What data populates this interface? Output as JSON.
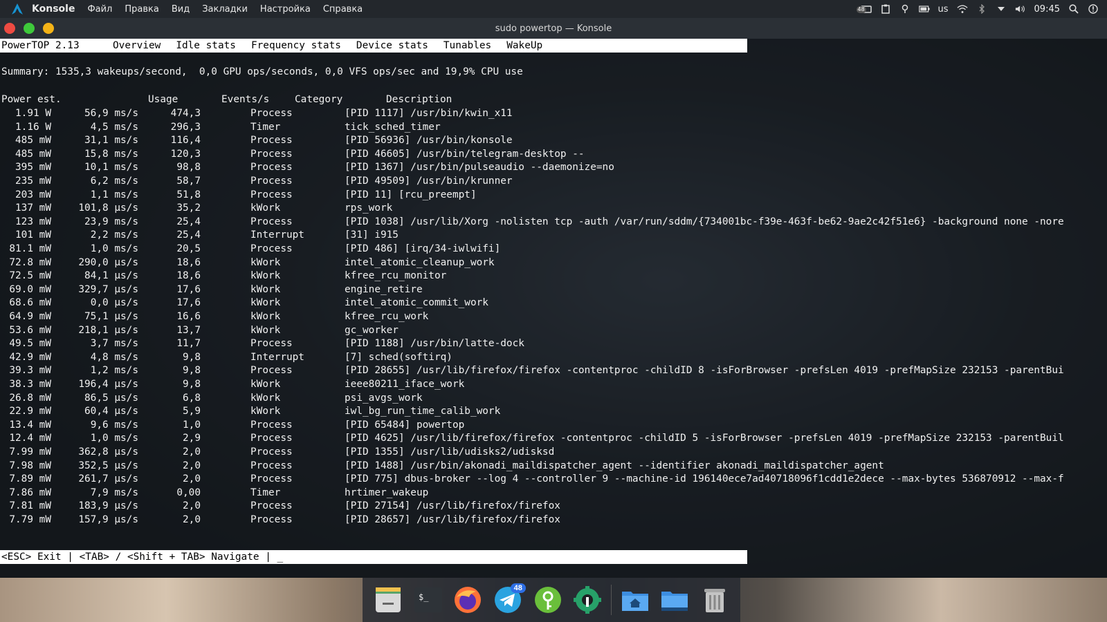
{
  "top_panel": {
    "app_name": "Konsole",
    "menu": [
      "Файл",
      "Правка",
      "Вид",
      "Закладки",
      "Настройка",
      "Справка"
    ],
    "tray": {
      "notifications_badge": "48",
      "keyboard_layout": "us",
      "clock": "09:45"
    }
  },
  "window": {
    "title": "sudo powertop — Konsole"
  },
  "powertop": {
    "version": "PowerTOP 2.13",
    "tabs": [
      "Overview",
      "Idle stats",
      "Frequency stats",
      "Device stats",
      "Tunables",
      "WakeUp"
    ],
    "active_tab": "Overview",
    "summary": "Summary: 1535,3 wakeups/second,  0,0 GPU ops/seconds, 0,0 VFS ops/sec and 19,9% CPU use",
    "columns": {
      "power": "Power est.",
      "usage": "Usage",
      "events": "Events/s",
      "category": "Category",
      "description": "Description"
    },
    "rows": [
      {
        "power": "1.91 W",
        "usage": "56,9 ms/s",
        "events": "474,3",
        "category": "Process",
        "description": "[PID 1117] /usr/bin/kwin_x11"
      },
      {
        "power": "1.16 W",
        "usage": "4,5 ms/s",
        "events": "296,3",
        "category": "Timer",
        "description": "tick_sched_timer"
      },
      {
        "power": "485 mW",
        "usage": "31,1 ms/s",
        "events": "116,4",
        "category": "Process",
        "description": "[PID 56936] /usr/bin/konsole"
      },
      {
        "power": "485 mW",
        "usage": "15,8 ms/s",
        "events": "120,3",
        "category": "Process",
        "description": "[PID 46605] /usr/bin/telegram-desktop --"
      },
      {
        "power": "395 mW",
        "usage": "10,1 ms/s",
        "events": "98,8",
        "category": "Process",
        "description": "[PID 1367] /usr/bin/pulseaudio --daemonize=no"
      },
      {
        "power": "235 mW",
        "usage": "6,2 ms/s",
        "events": "58,7",
        "category": "Process",
        "description": "[PID 49509] /usr/bin/krunner"
      },
      {
        "power": "203 mW",
        "usage": "1,1 ms/s",
        "events": "51,8",
        "category": "Process",
        "description": "[PID 11] [rcu_preempt]"
      },
      {
        "power": "137 mW",
        "usage": "101,8 µs/s",
        "events": "35,2",
        "category": "kWork",
        "description": "rps_work"
      },
      {
        "power": "123 mW",
        "usage": "23,9 ms/s",
        "events": "25,4",
        "category": "Process",
        "description": "[PID 1038] /usr/lib/Xorg -nolisten tcp -auth /var/run/sddm/{734001bc-f39e-463f-be62-9ae2c42f51e6} -background none -nore"
      },
      {
        "power": "101 mW",
        "usage": "2,2 ms/s",
        "events": "25,4",
        "category": "Interrupt",
        "description": "[31] i915"
      },
      {
        "power": "81.1 mW",
        "usage": "1,0 ms/s",
        "events": "20,5",
        "category": "Process",
        "description": "[PID 486] [irq/34-iwlwifi]"
      },
      {
        "power": "72.8 mW",
        "usage": "290,0 µs/s",
        "events": "18,6",
        "category": "kWork",
        "description": "intel_atomic_cleanup_work"
      },
      {
        "power": "72.5 mW",
        "usage": "84,1 µs/s",
        "events": "18,6",
        "category": "kWork",
        "description": "kfree_rcu_monitor"
      },
      {
        "power": "69.0 mW",
        "usage": "329,7 µs/s",
        "events": "17,6",
        "category": "kWork",
        "description": "engine_retire"
      },
      {
        "power": "68.6 mW",
        "usage": "0,0 µs/s",
        "events": "17,6",
        "category": "kWork",
        "description": "intel_atomic_commit_work"
      },
      {
        "power": "64.9 mW",
        "usage": "75,1 µs/s",
        "events": "16,6",
        "category": "kWork",
        "description": "kfree_rcu_work"
      },
      {
        "power": "53.6 mW",
        "usage": "218,1 µs/s",
        "events": "13,7",
        "category": "kWork",
        "description": "gc_worker"
      },
      {
        "power": "49.5 mW",
        "usage": "3,7 ms/s",
        "events": "11,7",
        "category": "Process",
        "description": "[PID 1188] /usr/bin/latte-dock"
      },
      {
        "power": "42.9 mW",
        "usage": "4,8 ms/s",
        "events": "9,8",
        "category": "Interrupt",
        "description": "[7] sched(softirq)"
      },
      {
        "power": "39.3 mW",
        "usage": "1,2 ms/s",
        "events": "9,8",
        "category": "Process",
        "description": "[PID 28655] /usr/lib/firefox/firefox -contentproc -childID 8 -isForBrowser -prefsLen 4019 -prefMapSize 232153 -parentBui"
      },
      {
        "power": "38.3 mW",
        "usage": "196,4 µs/s",
        "events": "9,8",
        "category": "kWork",
        "description": "ieee80211_iface_work"
      },
      {
        "power": "26.8 mW",
        "usage": "86,5 µs/s",
        "events": "6,8",
        "category": "kWork",
        "description": "psi_avgs_work"
      },
      {
        "power": "22.9 mW",
        "usage": "60,4 µs/s",
        "events": "5,9",
        "category": "kWork",
        "description": "iwl_bg_run_time_calib_work"
      },
      {
        "power": "13.4 mW",
        "usage": "9,6 ms/s",
        "events": "1,0",
        "category": "Process",
        "description": "[PID 65484] powertop"
      },
      {
        "power": "12.4 mW",
        "usage": "1,0 ms/s",
        "events": "2,9",
        "category": "Process",
        "description": "[PID 4625] /usr/lib/firefox/firefox -contentproc -childID 5 -isForBrowser -prefsLen 4019 -prefMapSize 232153 -parentBuil"
      },
      {
        "power": "7.99 mW",
        "usage": "362,8 µs/s",
        "events": "2,0",
        "category": "Process",
        "description": "[PID 1355] /usr/lib/udisks2/udisksd"
      },
      {
        "power": "7.98 mW",
        "usage": "352,5 µs/s",
        "events": "2,0",
        "category": "Process",
        "description": "[PID 1488] /usr/bin/akonadi_maildispatcher_agent --identifier akonadi_maildispatcher_agent"
      },
      {
        "power": "7.89 mW",
        "usage": "261,7 µs/s",
        "events": "2,0",
        "category": "Process",
        "description": "[PID 775] dbus-broker --log 4 --controller 9 --machine-id 196140ece7ad40718096f1cdd1e2dece --max-bytes 536870912 --max-f"
      },
      {
        "power": "7.86 mW",
        "usage": "7,9 ms/s",
        "events": "0,00",
        "category": "Timer",
        "description": "hrtimer_wakeup"
      },
      {
        "power": "7.81 mW",
        "usage": "183,9 µs/s",
        "events": "2,0",
        "category": "Process",
        "description": "[PID 27154] /usr/lib/firefox/firefox"
      },
      {
        "power": "7.79 mW",
        "usage": "157,9 µs/s",
        "events": "2,0",
        "category": "Process",
        "description": "[PID 28657] /usr/lib/firefox/firefox"
      }
    ],
    "status_bar": "<ESC> Exit | <TAB> / <Shift + TAB> Navigate | _"
  },
  "dock": {
    "items": [
      "notes-icon",
      "terminal-icon",
      "firefox-icon",
      "telegram-icon",
      "keepassxc-icon",
      "settings-icon",
      "home-folder-icon",
      "desktop-folder-icon",
      "trash-icon"
    ],
    "telegram_badge": "48",
    "terminal_glyph": "$_"
  },
  "colors": {
    "close": "#ee4b42",
    "minimize": "#3ec93b",
    "maximize": "#f4b317",
    "badge": "#2d6ee5"
  }
}
